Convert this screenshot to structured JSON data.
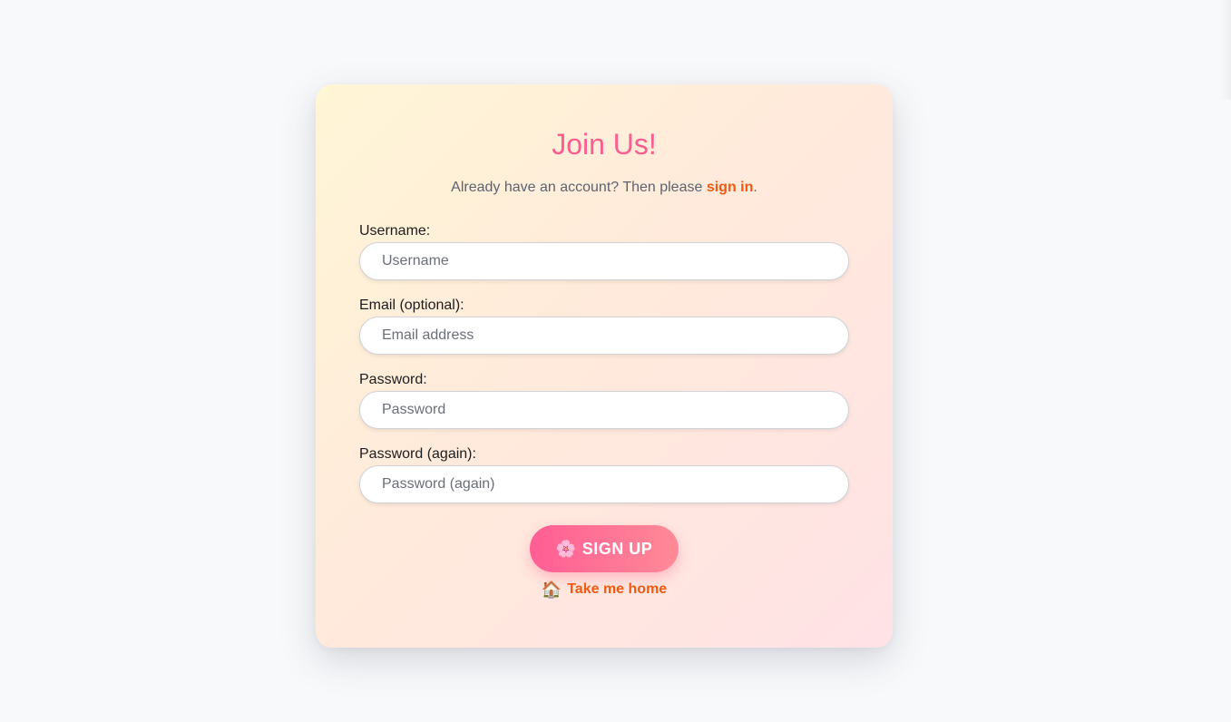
{
  "form": {
    "title": "Join Us!",
    "subtitle_prefix": "Already have an account? Then please ",
    "signin_label": "sign in",
    "subtitle_suffix": ".",
    "fields": [
      {
        "label": "Username:",
        "placeholder": "Username",
        "value": ""
      },
      {
        "label": "Email (optional):",
        "placeholder": "Email address",
        "value": ""
      },
      {
        "label": "Password:",
        "placeholder": "Password",
        "value": ""
      },
      {
        "label": "Password (again):",
        "placeholder": "Password (again)",
        "value": ""
      }
    ],
    "signup_icon": "🌸",
    "signup_label": "SIGN UP",
    "home_icon": "🏠",
    "home_label": "Take me home"
  },
  "icons": {
    "signup": "flower-icon",
    "home": "house-icon"
  },
  "colors": {
    "title": "#fa5d8f",
    "link": "#f05a12",
    "button_start": "#ff5d95",
    "button_end": "#ff8a96",
    "page_background": "#f8f9fb"
  }
}
